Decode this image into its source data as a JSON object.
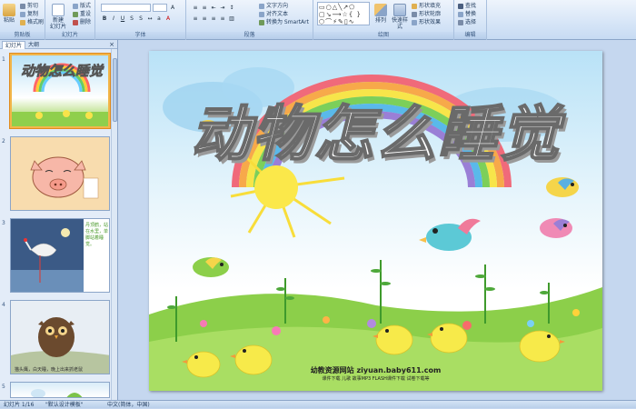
{
  "ribbon": {
    "clipboard": {
      "paste": "粘贴",
      "cut": "剪切",
      "copy": "复制",
      "format_painter": "格式刷",
      "group": "剪贴板"
    },
    "slides": {
      "new_slide": "新建\n幻灯片",
      "layout": "版式",
      "reset": "重设",
      "delete": "删除",
      "group": "幻灯片"
    },
    "font": {
      "font_name": "",
      "font_size": "",
      "group": "字体"
    },
    "paragraph": {
      "text_direction": "文字方向",
      "align_text": "对齐文本",
      "smartart": "转换为 SmartArt",
      "group": "段落"
    },
    "drawing": {
      "arrange": "排列",
      "quick_styles": "快速样式",
      "shape_fill": "形状填充",
      "shape_outline": "形状轮廓",
      "shape_effects": "形状效果",
      "group": "绘图"
    },
    "editing": {
      "find": "查找",
      "replace": "替换",
      "select": "选择",
      "group": "编辑"
    }
  },
  "panel": {
    "tabs": [
      "幻灯片",
      "大纲"
    ],
    "close": "×",
    "thumbnails": [
      {
        "num": "1",
        "title": "动物怎么睡觉"
      },
      {
        "num": "2",
        "title": ""
      },
      {
        "num": "3",
        "caption": "丹顶鹤，站在水里，单脚站着睡觉。"
      },
      {
        "num": "4",
        "caption": "猫头鹰，白天睡，晚上出来抓老鼠"
      },
      {
        "num": "5",
        "title": ""
      }
    ]
  },
  "slide": {
    "title": "动物怎么睡觉",
    "site": "幼教资源网站 ziyuan.baby611.com",
    "site_sub": "课件下载 儿歌 故事MP3 FLASH课件下载 试卷下载等"
  },
  "status": {
    "slide_info": "幻灯片 1/16",
    "theme": "\"默认设计模板\"",
    "language": "中文(简体，中国)"
  },
  "colors": {
    "ribbon_bg": "#d6e5f7",
    "workspace_bg": "#c5d7ef",
    "selected_thumb": "#f2b64a"
  }
}
